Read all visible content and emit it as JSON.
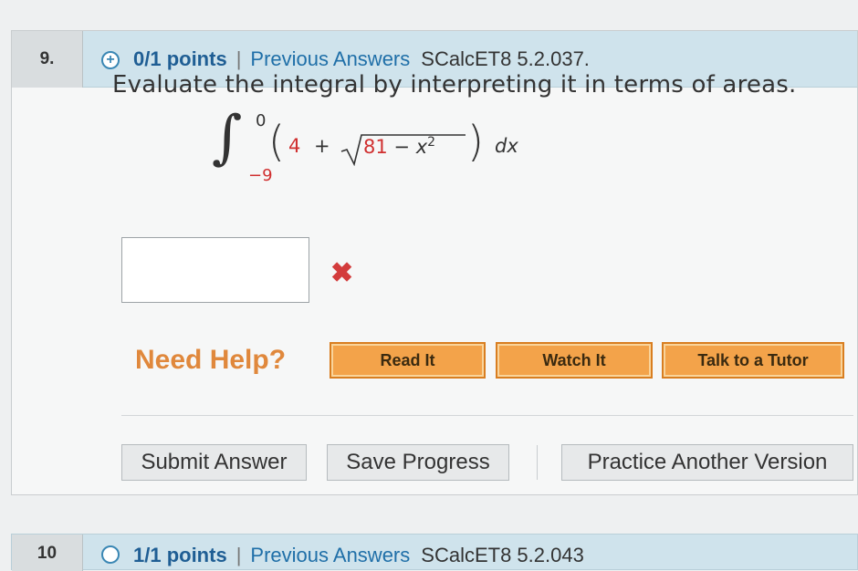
{
  "question": {
    "number": "9.",
    "points": "0/1 points",
    "separator": "|",
    "previous_answers": "Previous Answers",
    "code": "SCalcET8 5.2.037.",
    "prompt": "Evaluate the integral by interpreting it in terms of areas.",
    "integral": {
      "upper": "0",
      "lower": "−9",
      "const": "4",
      "plus": "+",
      "radicand_num": "81",
      "minus": "−",
      "var": "x",
      "exp": "2",
      "dx": "dx"
    },
    "answer_value": "",
    "status_icon": "x-mark-icon"
  },
  "help": {
    "label": "Need Help?",
    "buttons": [
      "Read It",
      "Watch It",
      "Talk to a Tutor"
    ]
  },
  "actions": {
    "submit": "Submit Answer",
    "save": "Save Progress",
    "practice": "Practice Another Version"
  },
  "next_question": {
    "number": "10",
    "points": "1/1 points",
    "separator": "|",
    "previous_answers": "Previous Answers",
    "code": "SCalcET8 5.2.043"
  },
  "colors": {
    "header_bg": "#cfe3ec",
    "points_blue": "#1f5e94",
    "link_blue": "#1f6fa8",
    "help_orange": "#e0883c",
    "button_orange": "#f3a34a",
    "wrong_red": "#d33c3c"
  }
}
